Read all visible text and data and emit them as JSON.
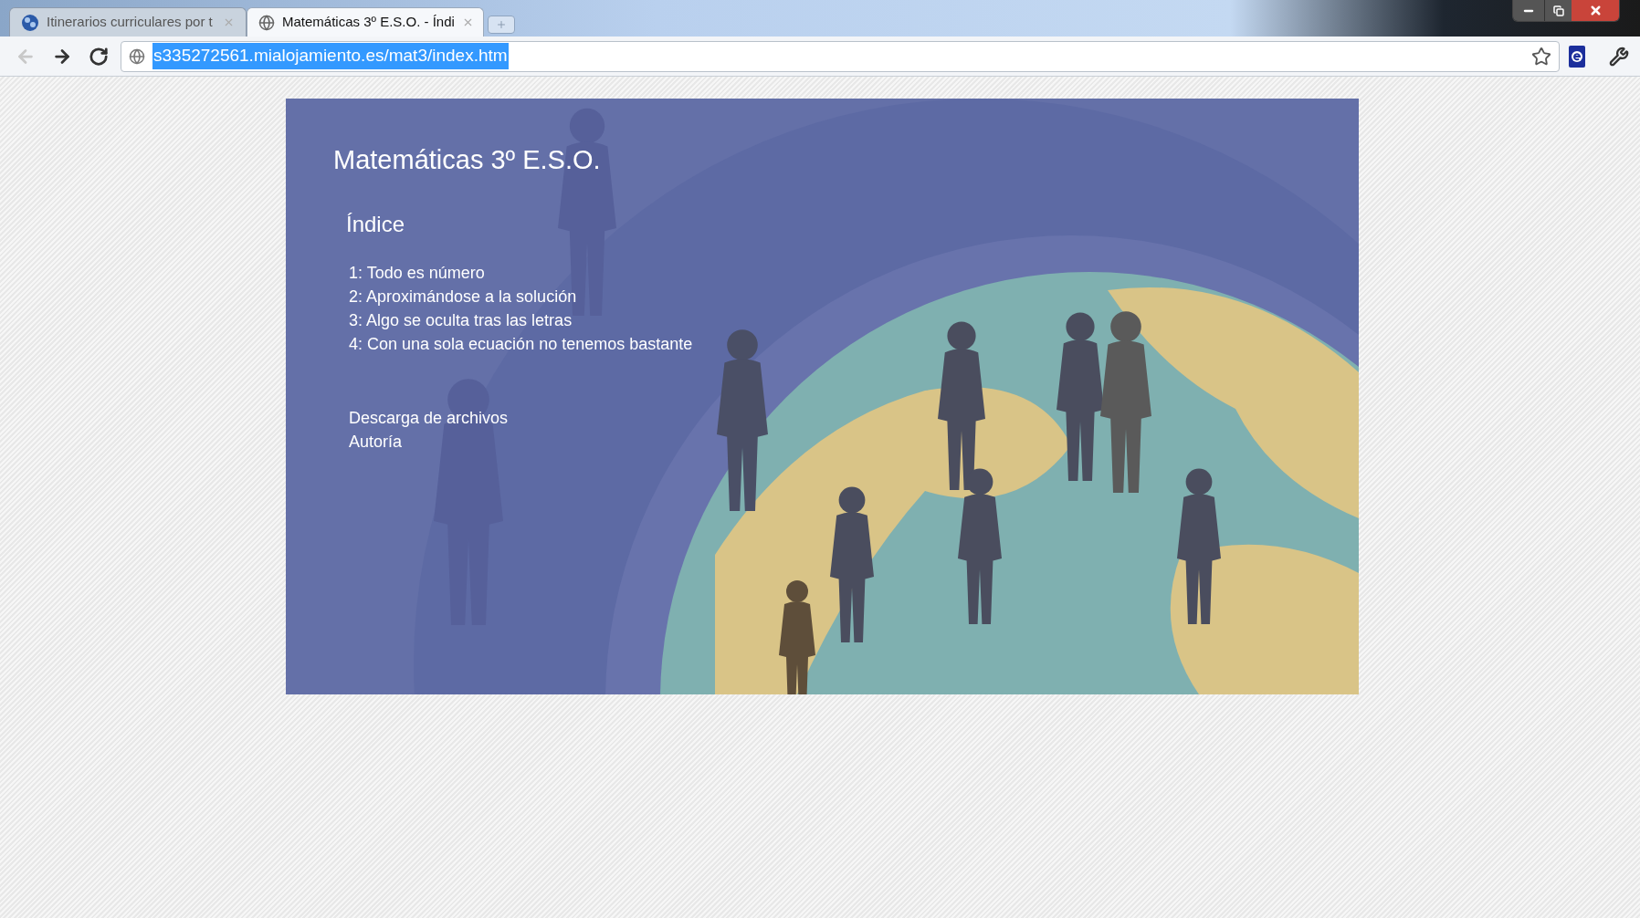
{
  "tabs": [
    {
      "title": "Itinerarios curriculares por t",
      "selected": false
    },
    {
      "title": "Matemáticas 3º E.S.O. - Índi",
      "selected": true
    }
  ],
  "navigation": [
    {
      "kind": "back",
      "disabled": true
    },
    {
      "kind": "forward",
      "disabled": false
    },
    {
      "kind": "reload",
      "disabled": false
    }
  ],
  "address_bar": {
    "value": "s335272561.mialojamiento.es/mat3/index.htm",
    "selected": true
  },
  "page": {
    "title": "Matemáticas 3º E.S.O.",
    "index_heading": "Índice",
    "chapters": [
      "1: Todo es número",
      "2: Aproximándose a la solución",
      "3: Algo se oculta tras las letras",
      "4: Con una sola ecuación no tenemos bastante"
    ],
    "links": [
      "Descarga de archivos",
      "Autoría"
    ]
  }
}
